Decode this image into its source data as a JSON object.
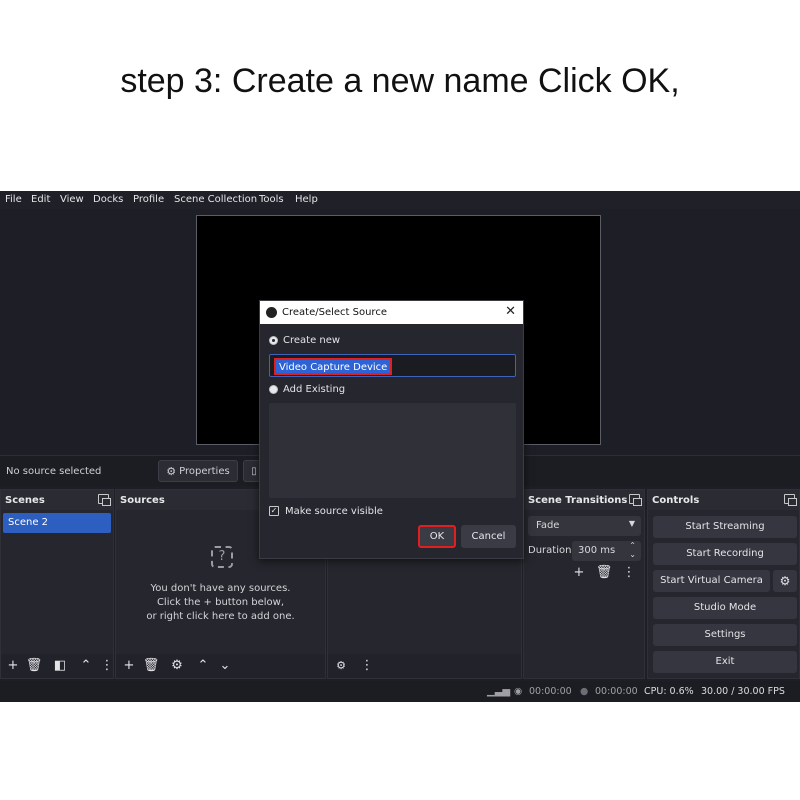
{
  "caption": "step 3: Create a new name Click OK,",
  "menu": [
    "File",
    "Edit",
    "View",
    "Docks",
    "Profile",
    "Scene Collection",
    "Tools",
    "Help"
  ],
  "context": {
    "no_source": "No source selected",
    "properties": "Properties"
  },
  "scenes": {
    "title": "Scenes",
    "items": [
      "Scene 2"
    ]
  },
  "sources": {
    "title": "Sources",
    "empty_line1": "You don't have any sources.",
    "empty_line2": "Click the + button below,",
    "empty_line3": "or right click here to add one."
  },
  "transitions": {
    "title": "Scene Transitions",
    "type": "Fade",
    "duration_label": "Duration",
    "duration_value": "300 ms"
  },
  "controls": {
    "title": "Controls",
    "start_streaming": "Start Streaming",
    "start_recording": "Start Recording",
    "start_virtual_camera": "Start Virtual Camera",
    "studio_mode": "Studio Mode",
    "settings": "Settings",
    "exit": "Exit"
  },
  "status": {
    "stream_time": "00:00:00",
    "record_time": "00:00:00",
    "cpu": "CPU: 0.6%",
    "fps": "30.00 / 30.00 FPS"
  },
  "dialog": {
    "title": "Create/Select Source",
    "create_new": "Create new",
    "name_value": "Video Capture Device",
    "add_existing": "Add Existing",
    "make_visible": "Make source visible",
    "ok": "OK",
    "cancel": "Cancel"
  },
  "colors": {
    "accent": "#2d5fc0",
    "highlight": "#e02020",
    "background": "#1e1f26"
  },
  "icons": [
    "add-icon",
    "trash-icon",
    "filter-icon",
    "up-icon",
    "down-icon",
    "gear-icon",
    "more-icon",
    "question-icon",
    "obs-logo-icon",
    "close-icon",
    "check-icon"
  ]
}
